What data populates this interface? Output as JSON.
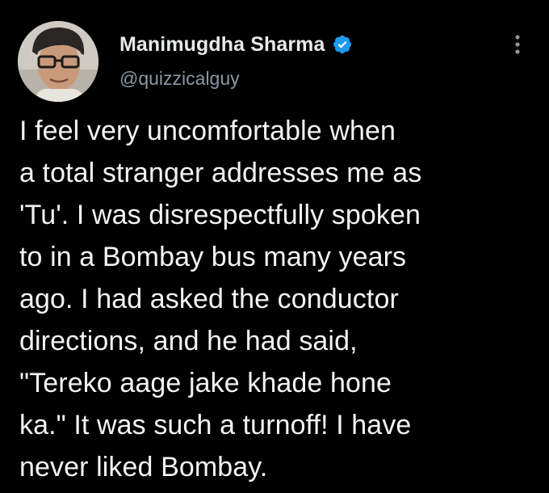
{
  "author": {
    "display_name": "Manimugdha Sharma",
    "handle": "@quizzicalguy",
    "verified": true
  },
  "icons": {
    "verified": "verified-badge-icon",
    "more": "more-options-icon"
  },
  "colors": {
    "background": "#000000",
    "text": "#e7e9ea",
    "secondary_text": "#8b98a5",
    "verified_blue": "#1d9bf0"
  },
  "tweet": {
    "lines": [
      "I feel very uncomfortable when",
      "a total stranger addresses me as",
      "'Tu'. I was disrespectfully spoken",
      "to in a Bombay bus many years",
      "ago. I had asked the conductor",
      "directions, and he had said,",
      "\"Tereko aage jake khade hone",
      "ka.\" It was such a turnoff! I have",
      "never liked Bombay."
    ]
  }
}
